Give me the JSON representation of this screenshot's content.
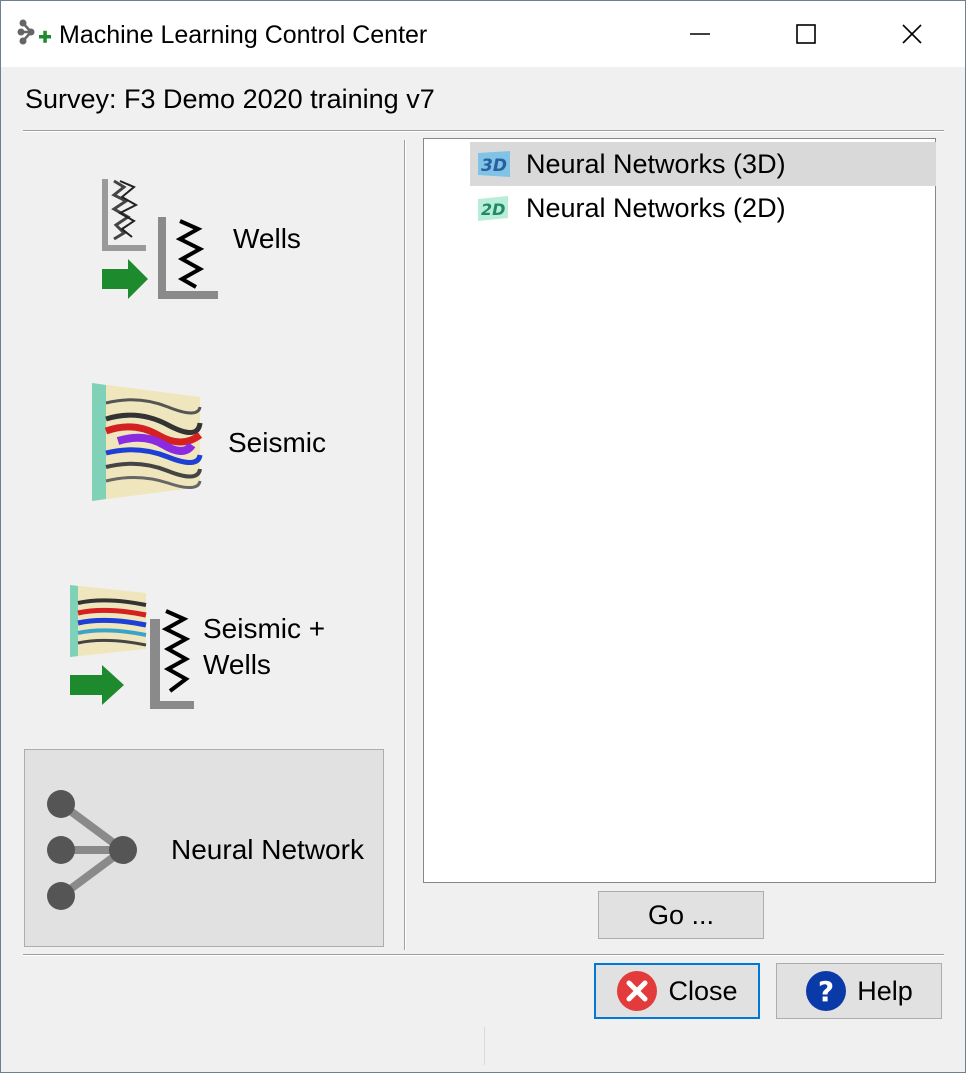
{
  "window": {
    "title": "Machine Learning Control Center",
    "icon": "ml-network-plus-icon",
    "controls": {
      "minimize": "minimize-icon",
      "maximize": "maximize-icon",
      "close": "close-icon"
    }
  },
  "survey_label": "Survey: F3 Demo 2020 training v7",
  "categories": [
    {
      "label": "Wells",
      "icon": "wells-icon"
    },
    {
      "label": "Seismic",
      "icon": "seismic-icon"
    },
    {
      "label_line1": "Seismic +",
      "label_line2": "Wells",
      "icon": "seismic-wells-icon"
    },
    {
      "label": "Neural Network",
      "icon": "neural-network-icon",
      "selected": true
    }
  ],
  "tree": {
    "items": [
      {
        "label": "Neural Networks (3D)",
        "icon": "3d-icon",
        "selected": true
      },
      {
        "label": "Neural Networks (2D)",
        "icon": "2d-icon",
        "selected": false
      }
    ]
  },
  "buttons": {
    "go": "Go ...",
    "close": "Close",
    "help": "Help"
  },
  "colors": {
    "accent": "#0078d7",
    "selection": "#d9d9d9",
    "arrow_green": "#1e8a2e",
    "close_red": "#e33b3b",
    "help_blue": "#0a3aa8"
  }
}
